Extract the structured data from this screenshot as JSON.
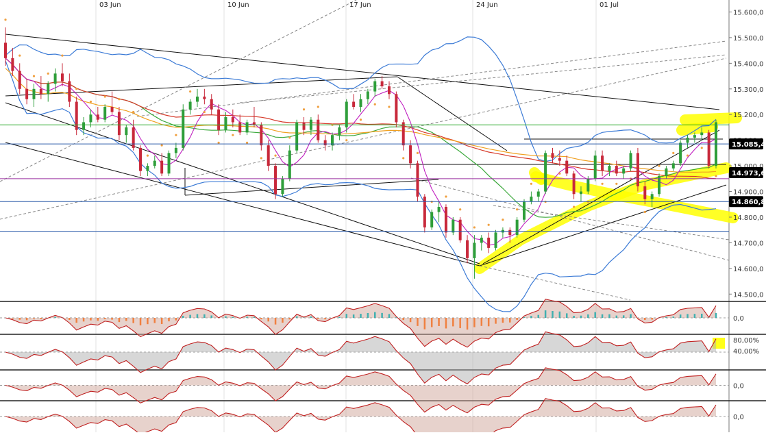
{
  "colors": {
    "up_candle": "#2e9e3a",
    "down_candle": "#c8283a",
    "bollinger": "#3c7bd6",
    "ma_red": "#d63a2a",
    "ma_green": "#3aa83a",
    "ma_orange": "#f0a020",
    "ma_magenta": "#c020c0",
    "parabolic_sar": "#f0a040",
    "highlighter": "#ffff00",
    "horizontal_blue": "#2a5aa8",
    "horizontal_green": "#2aa82a",
    "horizontal_purple": "#9a30a0",
    "hist_pos": "#40b0b0",
    "hist_neg": "#f08040",
    "price_tag_bg": "#000000"
  },
  "chart_data": {
    "type": "candlestick",
    "x_dates": [
      "03 Jun",
      "10 Jun",
      "17 Jun",
      "24 Jun",
      "01 Jul"
    ],
    "y_ticks": [
      "15.600,0",
      "15.500,0",
      "15.400,0",
      "15.300,0",
      "15.200,0",
      "15.100,0",
      "15.000,0",
      "14.900,0",
      "14.800,0",
      "14.700,0",
      "14.600,0",
      "14.500,0"
    ],
    "ylim": [
      14450,
      15620
    ],
    "price_tags": [
      {
        "label": "15.085,4",
        "value": 15085.4
      },
      {
        "label": "14.973,6",
        "value": 14973.6
      },
      {
        "label": "14.860,8",
        "value": 14860.8
      }
    ],
    "candles": [
      [
        15480,
        15540,
        15390,
        15420
      ],
      [
        15420,
        15460,
        15350,
        15370
      ],
      [
        15370,
        15400,
        15280,
        15300
      ],
      [
        15300,
        15340,
        15240,
        15260
      ],
      [
        15260,
        15320,
        15230,
        15300
      ],
      [
        15300,
        15350,
        15260,
        15280
      ],
      [
        15280,
        15330,
        15250,
        15320
      ],
      [
        15320,
        15380,
        15290,
        15360
      ],
      [
        15360,
        15400,
        15310,
        15330
      ],
      [
        15330,
        15360,
        15230,
        15250
      ],
      [
        15250,
        15270,
        15120,
        15140
      ],
      [
        15140,
        15190,
        15120,
        15170
      ],
      [
        15170,
        15220,
        15150,
        15200
      ],
      [
        15200,
        15230,
        15170,
        15180
      ],
      [
        15180,
        15240,
        15170,
        15230
      ],
      [
        15230,
        15290,
        15200,
        15210
      ],
      [
        15210,
        15230,
        15100,
        15120
      ],
      [
        15120,
        15160,
        15090,
        15150
      ],
      [
        15150,
        15180,
        15060,
        15070
      ],
      [
        15070,
        15080,
        14960,
        14980
      ],
      [
        14980,
        15010,
        14960,
        15000
      ],
      [
        15000,
        15040,
        14990,
        15020
      ],
      [
        15020,
        15050,
        14960,
        14970
      ],
      [
        14970,
        15060,
        14960,
        15050
      ],
      [
        15050,
        15090,
        15030,
        15070
      ],
      [
        15070,
        15240,
        15060,
        15220
      ],
      [
        15220,
        15260,
        15200,
        15250
      ],
      [
        15250,
        15300,
        15230,
        15270
      ],
      [
        15270,
        15300,
        15240,
        15260
      ],
      [
        15260,
        15280,
        15200,
        15220
      ],
      [
        15220,
        15240,
        15120,
        15140
      ],
      [
        15140,
        15210,
        15130,
        15190
      ],
      [
        15190,
        15220,
        15150,
        15170
      ],
      [
        15170,
        15200,
        15120,
        15130
      ],
      [
        15130,
        15180,
        15120,
        15170
      ],
      [
        15170,
        15230,
        15150,
        15160
      ],
      [
        15160,
        15170,
        15060,
        15080
      ],
      [
        15080,
        15100,
        14980,
        15000
      ],
      [
        15000,
        15010,
        14870,
        14890
      ],
      [
        14890,
        14960,
        14880,
        14950
      ],
      [
        14950,
        15080,
        14940,
        15060
      ],
      [
        15060,
        15180,
        15050,
        15170
      ],
      [
        15170,
        15190,
        15120,
        15140
      ],
      [
        15140,
        15190,
        15120,
        15180
      ],
      [
        15180,
        15200,
        15090,
        15100
      ],
      [
        15100,
        15120,
        15060,
        15080
      ],
      [
        15080,
        15130,
        15060,
        15120
      ],
      [
        15120,
        15160,
        15100,
        15150
      ],
      [
        15150,
        15260,
        15130,
        15250
      ],
      [
        15250,
        15280,
        15220,
        15230
      ],
      [
        15230,
        15280,
        15210,
        15260
      ],
      [
        15260,
        15300,
        15240,
        15290
      ],
      [
        15290,
        15340,
        15270,
        15330
      ],
      [
        15330,
        15350,
        15300,
        15310
      ],
      [
        15310,
        15330,
        15260,
        15280
      ],
      [
        15280,
        15290,
        15150,
        15170
      ],
      [
        15170,
        15180,
        15060,
        15080
      ],
      [
        15080,
        15100,
        14990,
        15010
      ],
      [
        15010,
        15020,
        14860,
        14880
      ],
      [
        14880,
        14890,
        14740,
        14760
      ],
      [
        14760,
        14830,
        14750,
        14820
      ],
      [
        14820,
        14860,
        14780,
        14840
      ],
      [
        14840,
        14850,
        14720,
        14740
      ],
      [
        14740,
        14800,
        14730,
        14790
      ],
      [
        14790,
        14800,
        14700,
        14710
      ],
      [
        14710,
        14730,
        14620,
        14640
      ],
      [
        14640,
        14730,
        14560,
        14700
      ],
      [
        14700,
        14730,
        14670,
        14720
      ],
      [
        14720,
        14740,
        14660,
        14680
      ],
      [
        14680,
        14750,
        14670,
        14740
      ],
      [
        14740,
        14760,
        14720,
        14750
      ],
      [
        14750,
        14760,
        14700,
        14730
      ],
      [
        14730,
        14800,
        14720,
        14790
      ],
      [
        14790,
        14870,
        14780,
        14860
      ],
      [
        14860,
        14900,
        14850,
        14880
      ],
      [
        14880,
        14910,
        14860,
        14900
      ],
      [
        14900,
        15060,
        14890,
        15050
      ],
      [
        15050,
        15070,
        15010,
        15030
      ],
      [
        15030,
        15060,
        15000,
        15020
      ],
      [
        15020,
        15040,
        14960,
        14970
      ],
      [
        14970,
        14980,
        14870,
        14890
      ],
      [
        14890,
        14920,
        14860,
        14900
      ],
      [
        14900,
        14960,
        14890,
        14950
      ],
      [
        14950,
        15060,
        14940,
        15040
      ],
      [
        15040,
        15060,
        14960,
        14980
      ],
      [
        14980,
        15010,
        14960,
        15000
      ],
      [
        15000,
        15020,
        14960,
        14970
      ],
      [
        14970,
        15000,
        14950,
        14990
      ],
      [
        14990,
        15060,
        14980,
        15050
      ],
      [
        15050,
        15070,
        14900,
        14920
      ],
      [
        14920,
        14940,
        14850,
        14870
      ],
      [
        14870,
        14900,
        14840,
        14890
      ],
      [
        14890,
        14970,
        14880,
        14960
      ],
      [
        14960,
        15000,
        14950,
        14990
      ],
      [
        14990,
        15020,
        14980,
        15010
      ],
      [
        15010,
        15100,
        15000,
        15090
      ],
      [
        15090,
        15120,
        15070,
        15110
      ],
      [
        15110,
        15130,
        15090,
        15120
      ],
      [
        15120,
        15150,
        15100,
        15130
      ],
      [
        15130,
        15140,
        14990,
        15000
      ],
      [
        15000,
        15180,
        14990,
        15170
      ]
    ],
    "indicators": [
      {
        "tick_labels": [
          "0,0"
        ]
      },
      {
        "tick_labels": [
          "80,00%",
          "40,00%"
        ]
      },
      {
        "tick_labels": [
          "0,0"
        ]
      },
      {
        "tick_labels": [
          "0,0"
        ]
      }
    ]
  }
}
